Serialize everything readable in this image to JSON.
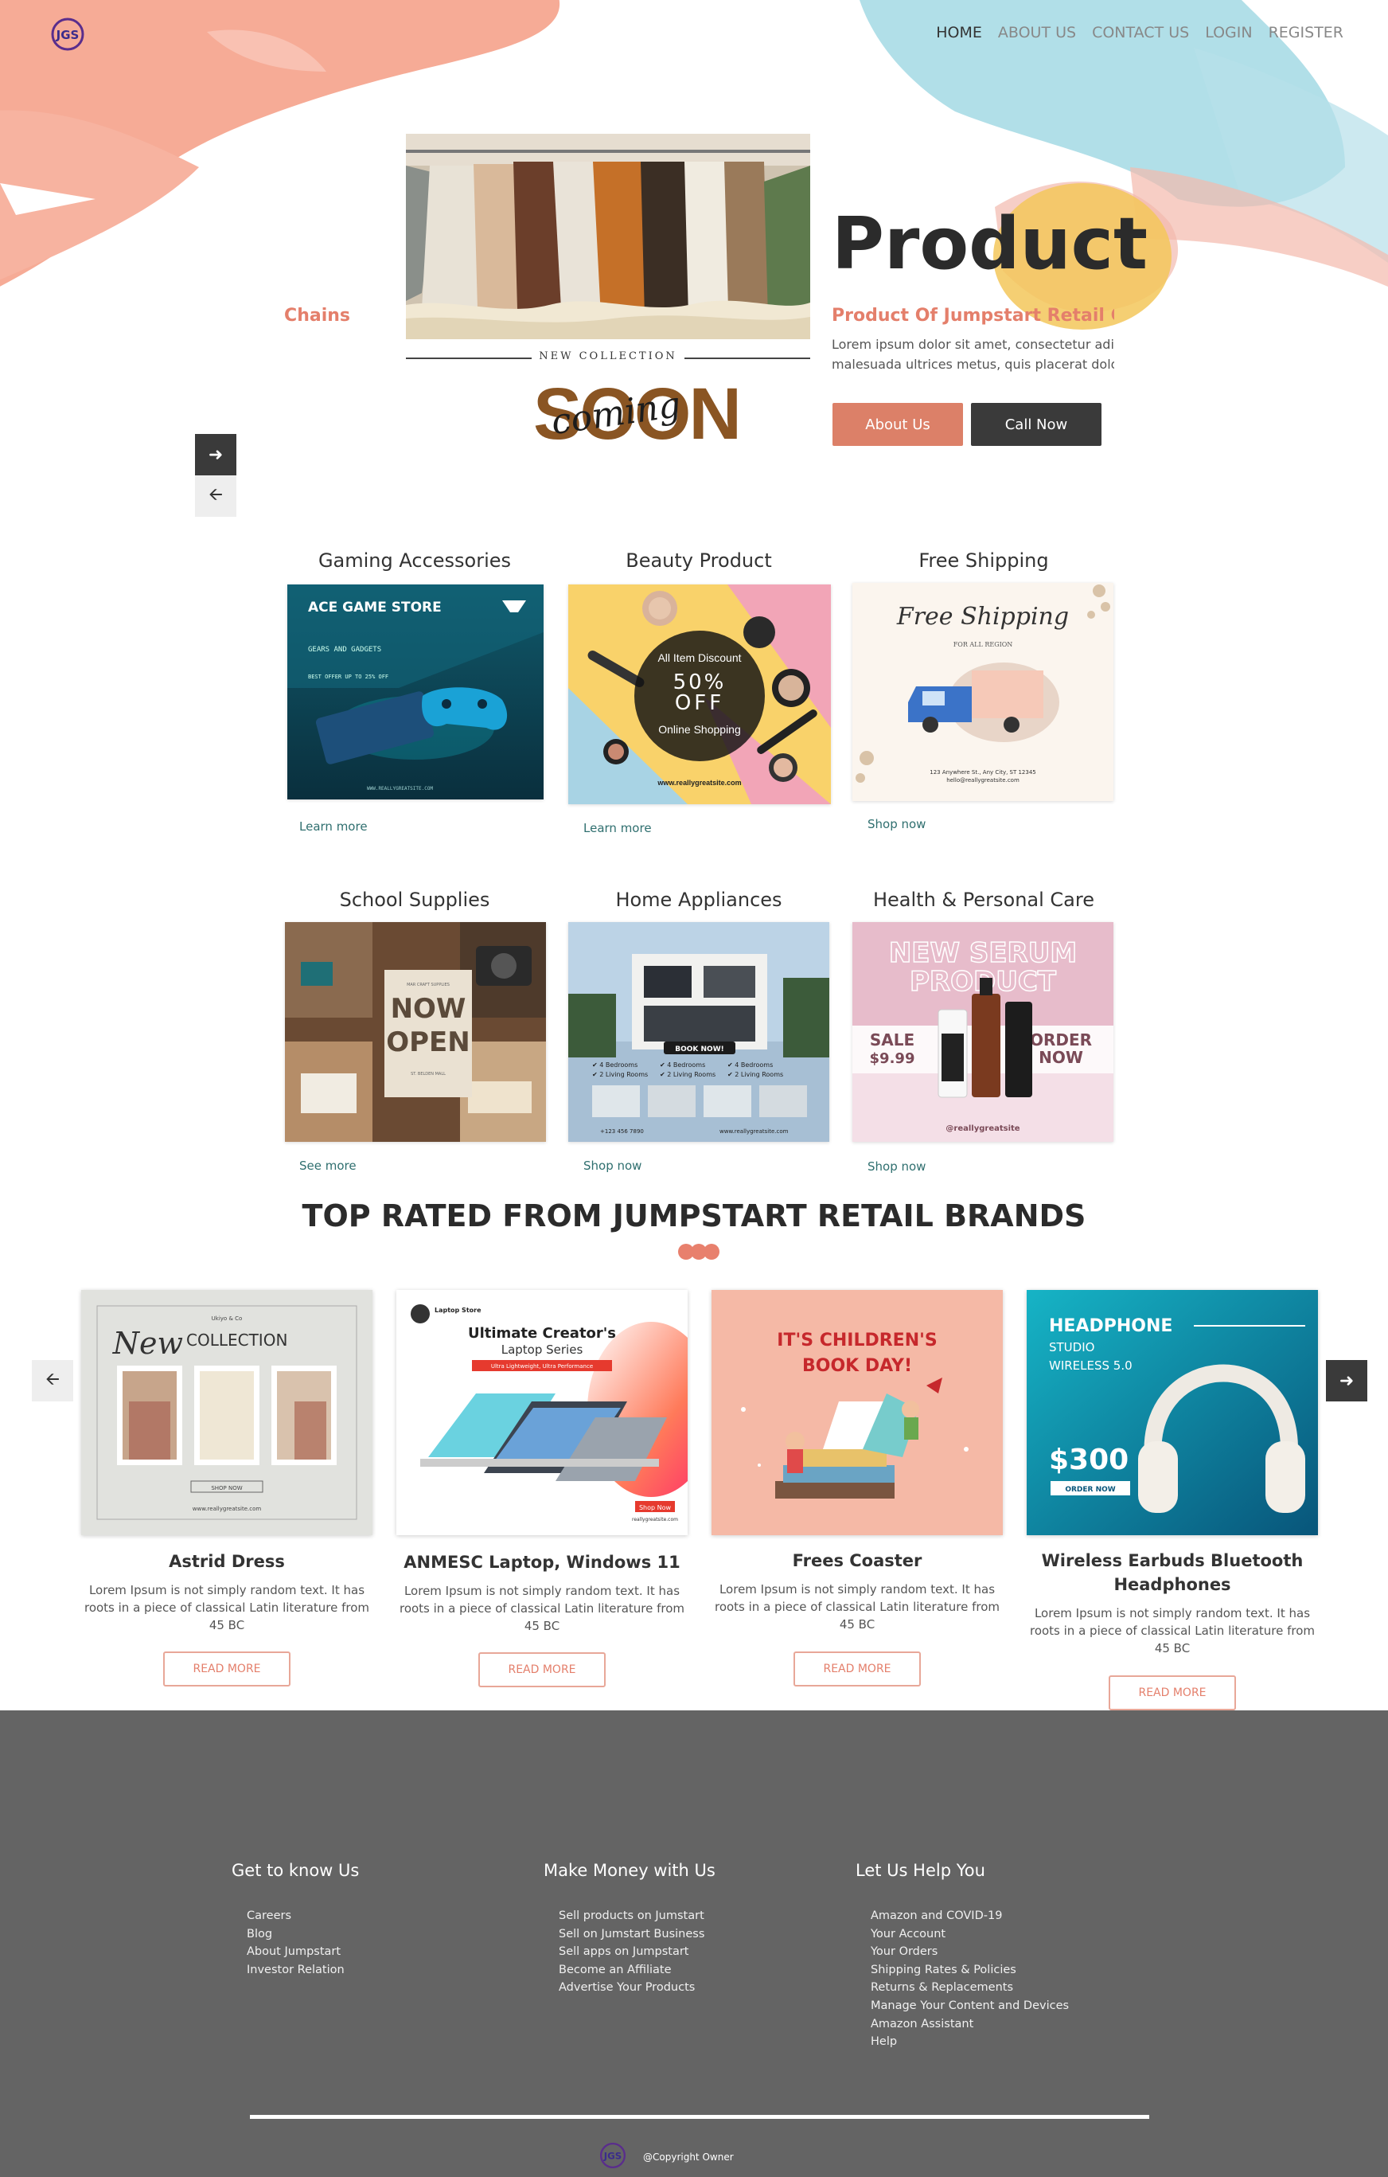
{
  "nav": {
    "items": [
      "HOME",
      "ABOUT US",
      "CONTACT US",
      "LOGIN",
      "REGISTER"
    ],
    "active": "HOME"
  },
  "logo": {
    "text": "JGS"
  },
  "hero": {
    "title": "Product",
    "subtitle": "Product Of Jumpstart Retail Chains",
    "ticker": "Chains",
    "description_line1": "Lorem ipsum dolor sit amet, consectetur adipiscing elit. Ut elit tellus, luctus nec ullamcorper mattis,",
    "description_line2": "malesuada ultrices metus, quis placerat dolor.",
    "btn_about": "About Us",
    "btn_call": "Call Now",
    "image": {
      "new_collection": "NEW COLLECTION",
      "soon": "SOON",
      "coming": "coming"
    }
  },
  "categories": [
    {
      "title": "Gaming Accessories",
      "link": "Learn more",
      "img": {
        "store": "ACE GAME STORE",
        "sub": "GEARS AND GADGETS",
        "offer": "BEST OFFER UP TO 25% OFF",
        "site": "WWW.REALLYGREATSITE.COM"
      }
    },
    {
      "title": "Beauty Product",
      "link": "Learn more",
      "img": {
        "l1": "All Item Discount",
        "l2": "50%",
        "l3": "OFF",
        "l4": "Online Shopping",
        "site": "www.reallygreatsite.com"
      }
    },
    {
      "title": "Free Shipping",
      "link": "Shop now",
      "img": {
        "l1": "Free Shipping",
        "l2": "FOR ALL REGION",
        "addr": "123 Anywhere St., Any City, ST 12345",
        "email": "hello@reallygreatsite.com"
      }
    },
    {
      "title": "School Supplies",
      "link": "See more",
      "img": {
        "l0": "MAR CRAFT SUPPLIES",
        "l1": "NOW",
        "l2": "OPEN",
        "l3": "ST. BELDEN MALL"
      }
    },
    {
      "title": "Home Appliances",
      "link": "Shop now",
      "img": {
        "book": "BOOK NOW!",
        "f1": "✔ 4 Bedrooms",
        "f2": "✔ 2 Living Rooms",
        "phone": "+123 456 7890",
        "site": "www.reallygreatsite.com"
      }
    },
    {
      "title": "Health & Personal Care",
      "link": "Shop now",
      "img": {
        "l1": "NEW SERUM",
        "l2": "PRODUCT",
        "sale": "SALE",
        "price": "$9.99",
        "order": "ORDER",
        "now": "NOW",
        "handle": "@reallygreatsite"
      }
    }
  ],
  "top_rated": {
    "title": "TOP RATED FROM JUMPSTART RETAIL BRANDS",
    "dots_color": "#e8806d"
  },
  "products": [
    {
      "name": "Astrid Dress",
      "desc": "Lorem Ipsum is not simply random text. It has roots in a piece of classical Latin literature from 45 BC",
      "btn": "READ MORE",
      "img": {
        "brand": "Ukiyo & Co",
        "l1": "New",
        "l2": "COLLECTION",
        "shop": "SHOP NOW",
        "site": "www.reallygreatsite.com"
      }
    },
    {
      "name": "ANMESC Laptop, Windows 11",
      "desc": "Lorem Ipsum is not simply random text. It has roots in a piece of classical Latin literature from 45 BC",
      "btn": "READ MORE",
      "img": {
        "store": "Laptop Store",
        "l1": "Ultimate Creator's",
        "l2": "Laptop Series",
        "l3": "Ultra Lightweight, Ultra Performance",
        "shop": "Shop Now",
        "site": "reallygreatsite.com"
      }
    },
    {
      "name": "Frees Coaster",
      "desc": "Lorem Ipsum is not simply random text. It has roots in a piece of classical Latin literature from 45 BC",
      "btn": "READ MORE",
      "img": {
        "l1": "IT'S CHILDREN'S",
        "l2": "BOOK DAY!"
      }
    },
    {
      "name": "Wireless Earbuds Bluetooth Headphones",
      "desc": "Lorem Ipsum is not simply random text. It has roots in a piece of classical Latin literature from 45 BC",
      "btn": "READ MORE",
      "img": {
        "l1": "HEADPHONE",
        "l2": "STUDIO",
        "l3": "WIRELESS 5.0",
        "price": "$300",
        "order": "ORDER NOW"
      }
    }
  ],
  "footer": {
    "col1": {
      "title": "Get to know Us",
      "links": [
        "Careers",
        "Blog",
        "About Jumpstart",
        "Investor Relation"
      ]
    },
    "col2": {
      "title": "Make Money with Us",
      "links": [
        "Sell products on Jumstart",
        "Sell on Jumstart Business",
        "Sell apps on Jumpstart",
        "Become an Affiliate",
        "Advertise Your Products"
      ]
    },
    "col3": {
      "title": "Let Us Help You",
      "links": [
        "Amazon and COVID-19",
        "Your Account",
        "Your Orders",
        "Shipping Rates & Policies",
        "Returns & Replacements",
        "Manage Your Content and Devices",
        "Amazon Assistant",
        "Help"
      ]
    },
    "copyright": "@Copyright Owner"
  },
  "colors": {
    "accent": "#e47f6b",
    "dark": "#3a3a3a",
    "footer_bg": "#646464",
    "link": "#2f6f6f"
  }
}
